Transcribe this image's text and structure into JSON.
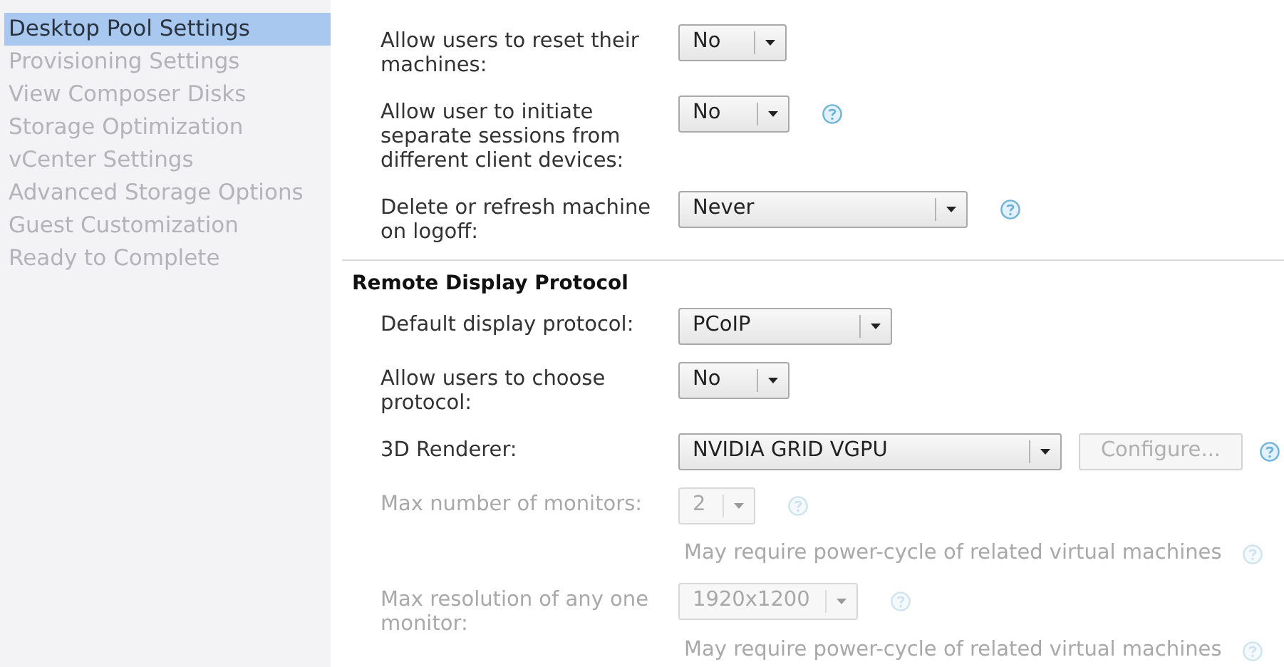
{
  "sidebar": {
    "items": [
      {
        "label": "Desktop Pool Settings",
        "selected": true,
        "disabled": false
      },
      {
        "label": "Provisioning Settings",
        "selected": false,
        "disabled": true
      },
      {
        "label": "View Composer Disks",
        "selected": false,
        "disabled": true
      },
      {
        "label": "Storage Optimization",
        "selected": false,
        "disabled": true
      },
      {
        "label": "vCenter Settings",
        "selected": false,
        "disabled": true
      },
      {
        "label": "Advanced Storage Options",
        "selected": false,
        "disabled": true
      },
      {
        "label": "Guest Customization",
        "selected": false,
        "disabled": true
      },
      {
        "label": "Ready to Complete",
        "selected": false,
        "disabled": true
      }
    ]
  },
  "settings": [
    {
      "kind": "setting",
      "label": "Allow users to reset their machines:",
      "value": "No",
      "help": false,
      "disabled": false
    },
    {
      "kind": "setting",
      "label": "Allow user to initiate separate sessions from different client devices:",
      "value": "No",
      "help": true,
      "disabled": false
    },
    {
      "kind": "setting",
      "label": "Delete or refresh machine on logoff:",
      "value": "Never",
      "help": true,
      "disabled": false
    }
  ],
  "remote_display_protocol": {
    "title": "Remote Display Protocol",
    "settings": [
      {
        "kind": "setting",
        "label": "Default display protocol:",
        "value": "PCoIP",
        "help": false,
        "disabled": false
      },
      {
        "kind": "setting",
        "label": "Allow users to choose protocol:",
        "value": "No",
        "help": false,
        "disabled": false
      },
      {
        "kind": "setting",
        "label": "3D Renderer:",
        "value": "NVIDIA GRID VGPU",
        "help": true,
        "disabled": false,
        "button": {
          "label": "Configure...",
          "disabled": true
        }
      },
      {
        "kind": "setting",
        "label": "Max number of monitors:",
        "value": "2",
        "help": true,
        "disabled": true
      },
      {
        "kind": "note",
        "text": "May require power-cycle of related virtual machines",
        "help": true
      },
      {
        "kind": "setting",
        "label": "Max resolution of any one monitor:",
        "value": "1920x1200",
        "help": true,
        "disabled": true
      },
      {
        "kind": "note",
        "text": "May require power-cycle of related virtual machines",
        "help": true
      }
    ]
  }
}
